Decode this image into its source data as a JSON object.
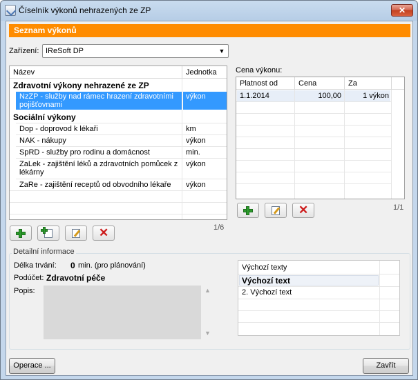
{
  "window": {
    "title": "Číselník výkonů nehrazených ze ZP",
    "close_glyph": "✕"
  },
  "header": {
    "title": "Seznam výkonů"
  },
  "facility": {
    "label": "Zařízení:",
    "value": "IReSoft DP"
  },
  "services": {
    "columns": [
      "Název",
      "Jednotka"
    ],
    "rows": [
      {
        "name": "Zdravotní výkony nehrazené ze ZP",
        "unit": "",
        "type": "group"
      },
      {
        "name_line1": "NzZP - služby nad rámec hrazení zdravotními",
        "name_line2": "pojišťovnami",
        "unit": "výkon",
        "type": "item",
        "selected": true
      },
      {
        "name": "Sociální výkony",
        "unit": "",
        "type": "group"
      },
      {
        "name": "Dop - doprovod k lékaři",
        "unit": "km",
        "type": "item"
      },
      {
        "name": "NAK - nákupy",
        "unit": "výkon",
        "type": "item"
      },
      {
        "name": "SpRD - služby pro rodinu a domácnost",
        "unit": "min.",
        "type": "item"
      },
      {
        "name_line1": "ZaLek - zajištění léků a zdravotních pomůcek z",
        "name_line2": "lékárny",
        "unit": "výkon",
        "type": "item"
      },
      {
        "name": "ZaRe - zajištění receptů od obvodního lékaře",
        "unit": "výkon",
        "type": "item"
      }
    ],
    "pager": "1/6"
  },
  "price": {
    "label": "Cena výkonu:",
    "columns": [
      "Platnost od",
      "Cena",
      "Za"
    ],
    "rows": [
      {
        "valid_from": "1.1.2014",
        "price": "100,00",
        "per": "1 výkon"
      }
    ],
    "pager": "1/1"
  },
  "detail": {
    "group_title": "Detailní informace",
    "duration_label": "Délka trvání:",
    "duration_value": "0",
    "duration_unit": "min. (pro plánování)",
    "subaccount_label": "Podúčet:",
    "subaccount_value": "Zdravotní péče",
    "description_label": "Popis:",
    "texts": [
      "Výchozí texty",
      "Výchozí text",
      "2. Výchozí text"
    ]
  },
  "footer": {
    "operations_label": "Operace ...",
    "close_label": "Zavřít"
  },
  "colors": {
    "accent": "#ff8c00",
    "selection": "#3399ff",
    "add": "#2c9a2c",
    "delete": "#cc1a1a"
  }
}
